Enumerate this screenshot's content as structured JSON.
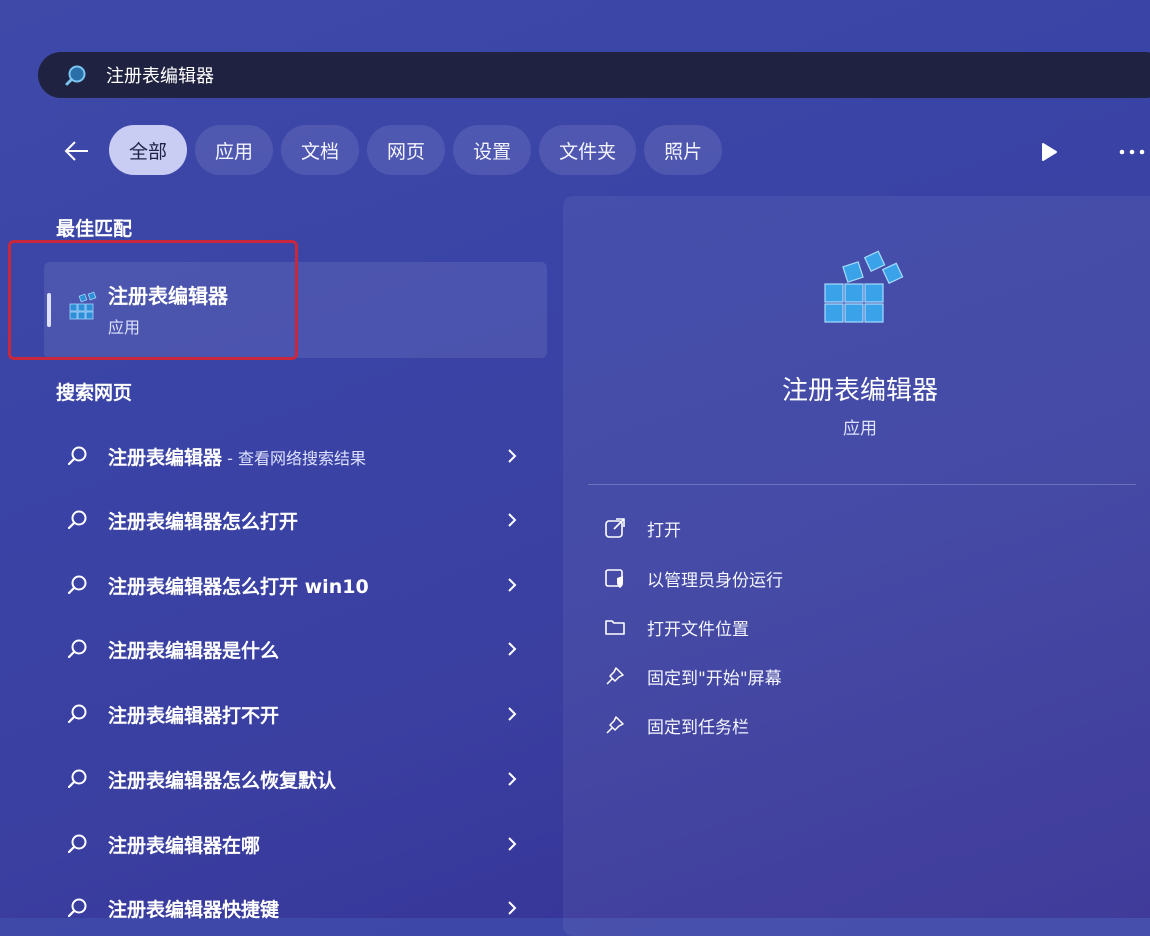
{
  "search": {
    "value": "注册表编辑器"
  },
  "tabs": [
    {
      "label": "全部",
      "active": true
    },
    {
      "label": "应用"
    },
    {
      "label": "文档"
    },
    {
      "label": "网页"
    },
    {
      "label": "设置"
    },
    {
      "label": "文件夹"
    },
    {
      "label": "照片"
    }
  ],
  "best_match": {
    "section_title": "最佳匹配",
    "name": "注册表编辑器",
    "type": "应用"
  },
  "web_search": {
    "section_title": "搜索网页",
    "items": [
      {
        "prefix": "注册表编辑器",
        "suffix": " - 查看网络搜索结果"
      },
      {
        "prefix": "注册表编辑器",
        "suffix": "怎么打开"
      },
      {
        "prefix": "注册表编辑器",
        "suffix": "怎么打开 win10"
      },
      {
        "prefix": "注册表编辑器",
        "suffix": "是什么"
      },
      {
        "prefix": "注册表编辑器",
        "suffix": "打不开"
      },
      {
        "prefix": "注册表编辑器",
        "suffix": "怎么恢复默认"
      },
      {
        "prefix": "注册表编辑器",
        "suffix": "在哪"
      },
      {
        "prefix": "注册表编辑器",
        "suffix": "快捷键"
      }
    ]
  },
  "preview": {
    "name": "注册表编辑器",
    "type": "应用",
    "actions": [
      {
        "label": "打开",
        "icon": "open-external-icon"
      },
      {
        "label": "以管理员身份运行",
        "icon": "admin-shield-icon"
      },
      {
        "label": "打开文件位置",
        "icon": "folder-icon"
      },
      {
        "label": "固定到\"开始\"屏幕",
        "icon": "pin-icon"
      },
      {
        "label": "固定到任务栏",
        "icon": "pin-icon"
      }
    ]
  },
  "colors": {
    "background": "#3a44a6",
    "search_bar": "#1f2240",
    "active_tab": "#c9cdf3",
    "highlight_border": "#c9283c",
    "registry_icon": "#3fa7e6"
  }
}
